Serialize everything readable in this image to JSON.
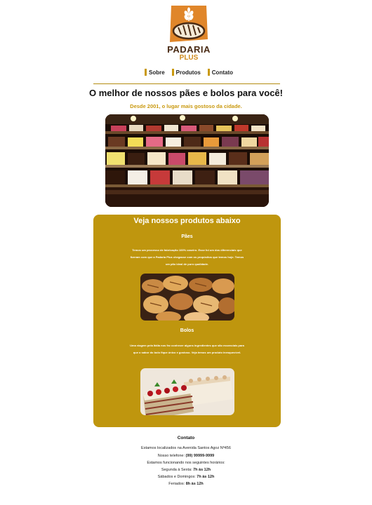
{
  "brand": {
    "name": "PADARIA",
    "sub": "PLUS"
  },
  "nav": {
    "items": [
      {
        "label": "Sobre"
      },
      {
        "label": "Produtos"
      },
      {
        "label": "Contato"
      }
    ]
  },
  "hero": {
    "headline": "O melhor de nossos pães e bolos para você!",
    "tagline": "Desde 2001, o lugar mais gostoso da cidade."
  },
  "products": {
    "title": "Veja nossos produtos abaixo",
    "breads": {
      "title": "Pães",
      "text": "Temos um processo de fabricação 100% caseiro. Esse foi um dos diferenciais que fizeram com que a Padaria Plus chegasse com os propósitos que temos hoje. Temos um pão ideal de puro qualidade."
    },
    "cakes": {
      "title": "Bolos",
      "text": "Uma viagem pela Itália nos fez conhecer alguns ingredientes que são essenciais para que o sabor do bolo fique único e gostoso. Veja temos um produto inesquecível."
    }
  },
  "contact": {
    "title": "Contato",
    "address": "Estamos localizados na Avenida Santos Agoz Nº456",
    "phone_label": "Nosso telefone:",
    "phone": "(99) 99999-9999",
    "hours_intro": "Estamos funcionando nos seguintes horários:",
    "weekdays_label": "Segunda à Sexta:",
    "weekdays_hours": "7h às 12h",
    "weekend_label": "Sábados e Domingos:",
    "weekend_hours": "7h às 12h",
    "holidays_label": "Feriados:",
    "holidays_hours": "8h às 12h"
  },
  "colors": {
    "accent": "#bf960e",
    "logo_orange": "#e0862a",
    "logo_brown": "#4a2b14"
  }
}
